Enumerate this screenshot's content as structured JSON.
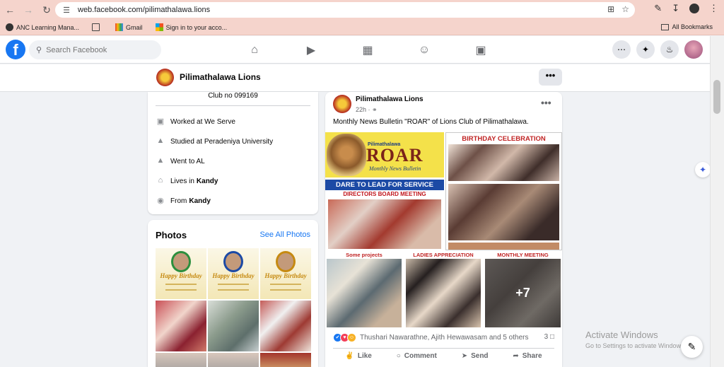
{
  "browser": {
    "url": "web.facebook.com/pilimathalawa.lions",
    "bookmarks": [
      {
        "label": "ANC Learning Mana..."
      },
      {
        "label": ""
      },
      {
        "label": "Gmail"
      },
      {
        "label": "Sign in to your acco..."
      }
    ],
    "all_bookmarks_label": "All Bookmarks"
  },
  "fb": {
    "search_placeholder": "Search Facebook",
    "nav_icons": [
      "home-icon",
      "video-icon",
      "marketplace-icon",
      "groups-icon",
      "gaming-icon"
    ]
  },
  "page": {
    "name": "Pilimathalawa Lions",
    "more_label": "•••"
  },
  "intro": {
    "club_no": "Club no 099169",
    "rows": [
      {
        "icon": "briefcase-icon",
        "text": "Worked at We Serve",
        "bold": ""
      },
      {
        "icon": "graduation-cap-icon",
        "text": "Studied at Peradeniya University",
        "bold": ""
      },
      {
        "icon": "graduation-cap-icon",
        "text": "Went to AL",
        "bold": ""
      },
      {
        "icon": "home-icon",
        "text": "Lives in",
        "bold": "Kandy"
      },
      {
        "icon": "location-pin-icon",
        "text": "From",
        "bold": "Kandy"
      }
    ]
  },
  "photos": {
    "title": "Photos",
    "see_all": "See All Photos",
    "birthday_text": "Happy Birthday"
  },
  "post": {
    "author": "Pilimathalawa Lions",
    "time": "22h · ",
    "more": "•••",
    "text": "Monthly News Bulletin \"ROAR\" of Lions Club of Pilimathalawa.",
    "media": {
      "roar_small": "Pilimathalawa",
      "roar_word": "ROAR",
      "roar_sub": "Monthly News Bulletin",
      "dare": "DARE TO LEAD  FOR SERVICE",
      "directors": "DIRECTORS BOARD MEETING",
      "birthday_title": "BIRTHDAY CELEBRATION",
      "tiles": [
        "Some projects",
        "LADIES APPRECIATION",
        "MONTHLY MEETING"
      ],
      "more_count": "+7"
    },
    "reactions_text": "Thushari Nawarathne, Ajith Hewawasam and 5 others",
    "comments_count": "3",
    "actions": [
      "Like",
      "Comment",
      "Send",
      "Share"
    ]
  },
  "system": {
    "activate_title": "Activate Windows",
    "activate_sub": "Go to Settings to activate Windows."
  }
}
